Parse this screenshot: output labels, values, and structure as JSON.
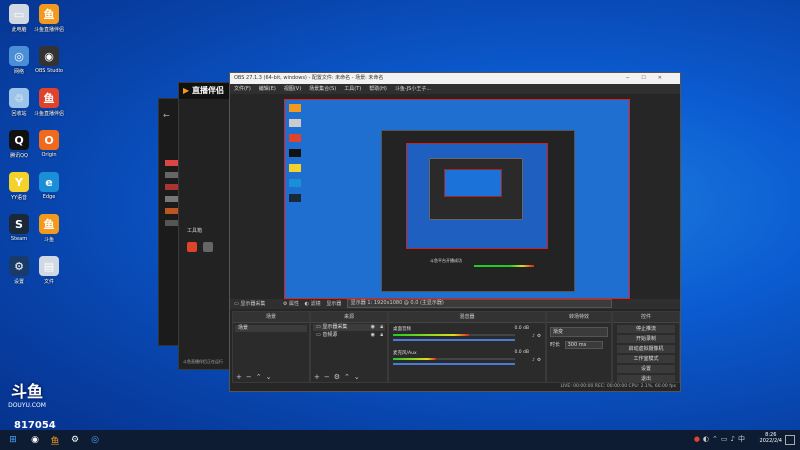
{
  "desktop_icons": [
    {
      "label": "此电脑",
      "color": "#cfd8e3",
      "glyph": "▭"
    },
    {
      "label": "斗鱼直播伴侣",
      "color": "#f39a1e",
      "glyph": "鱼"
    },
    {
      "label": "网络",
      "color": "#4a8fd6",
      "glyph": "◎"
    },
    {
      "label": "OBS Studio",
      "color": "#333",
      "glyph": "◉"
    },
    {
      "label": "回收站",
      "color": "#9cc4ea",
      "glyph": "♲"
    },
    {
      "label": "斗鱼直播伴侣",
      "color": "#e0432c",
      "glyph": "鱼"
    },
    {
      "label": "腾讯QQ",
      "color": "#111",
      "glyph": "Q"
    },
    {
      "label": "Origin",
      "color": "#f06a1c",
      "glyph": "O"
    },
    {
      "label": "YY语音",
      "color": "#f5d22b",
      "glyph": "Y"
    },
    {
      "label": "Edge",
      "color": "#1a8fd8",
      "glyph": "e"
    },
    {
      "label": "Steam",
      "color": "#1b2838",
      "glyph": "S"
    },
    {
      "label": "斗鱼",
      "color": "#f39a1e",
      "glyph": "鱼"
    },
    {
      "label": "设置",
      "color": "#1a3a6a",
      "glyph": "⚙"
    },
    {
      "label": "文件",
      "color": "#cfd8e3",
      "glyph": "▤"
    }
  ],
  "watermark": {
    "brand": "斗鱼",
    "site": "DOUYU.COM",
    "room": "817054"
  },
  "douyu_app": {
    "title": "直播伴侣",
    "tools_label": "工具箱",
    "warning": "斗鱼直播伴侣正在运行"
  },
  "obs": {
    "title": "OBS 27.1.3 (64-bit, windows) - 配置文件: 未命名 - 场景: 未命名",
    "menu": [
      "文件(F)",
      "编辑(E)",
      "视图(V)",
      "场景集合(S)",
      "工具(T)",
      "帮助(H)",
      "斗鱼-JS小王子..."
    ],
    "source_bar": {
      "name": "显示器采集",
      "props": "属性",
      "filters": "滤镜",
      "display_label": "显示器",
      "display_value": "显示器 1: 1920x1080 @ 0,0 (主显示器)"
    },
    "docks": {
      "scenes": "场景",
      "sources": "来源",
      "mixer": "混音器",
      "transitions": "转场特效",
      "controls": "控件"
    },
    "scene_item": "场景",
    "source_items": [
      "显示器采集",
      "音频源"
    ],
    "mixer": [
      {
        "name": "桌面音频",
        "db": "0.0 dB",
        "level": 0.62
      },
      {
        "name": "麦克风/Aux",
        "db": "0.0 dB",
        "level": 0.35
      }
    ],
    "transition": {
      "type": "渐变",
      "duration_label": "时长",
      "duration": "300 ms"
    },
    "controls": [
      "停止推流",
      "开始录制",
      "启动虚拟摄像机",
      "工作室模式",
      "设置",
      "退出"
    ],
    "status": "LIVE: 00:00:00    REC: 00:00:00    CPU: 2.1%, 60.00 fps"
  },
  "nested_caption": "斗鱼平台开播成功",
  "taskbar": {
    "time": "8:26",
    "date": "2022/2/4"
  }
}
